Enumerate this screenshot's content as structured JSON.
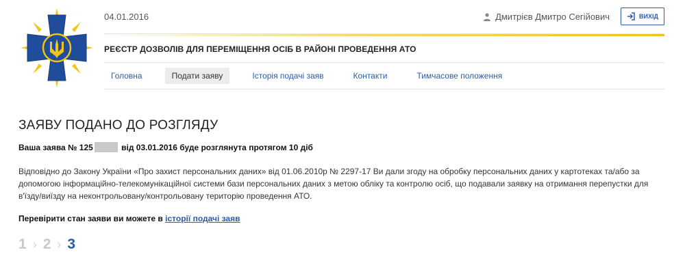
{
  "header": {
    "date": "04.01.2016",
    "user_name": "Дмитрієв Дмитро Сегійович",
    "logout_label": "ВИХІД",
    "site_title": "РЕЄСТР ДОЗВОЛІВ ДЛЯ ПЕРЕМІЩЕННЯ ОСІБ В РАЙОНІ ПРОВЕДЕННЯ АТО"
  },
  "nav": {
    "items": [
      {
        "label": "Головна"
      },
      {
        "label": "Подати заяву",
        "active": true
      },
      {
        "label": "Історія подачі заяв"
      },
      {
        "label": "Контакти"
      },
      {
        "label": "Тимчасове положення"
      }
    ]
  },
  "main": {
    "title": "ЗАЯВУ ПОДАНО ДО РОЗГЛЯДУ",
    "application_prefix": "Ваша заява № 125",
    "application_suffix": "від 03.01.2016 буде розглянута протягом 10 діб",
    "consent_text": "Відповідно до Закону України «Про захист персональних даних» від 01.06.2010р № 2297-17 Ви дали згоду на обробку персональних даних у картотеках та/або за допомогою інформаційно-телекомунікаційної системи бази персональних даних з метою обліку та контролю осіб, що подавали заявку на отримання перепустки для в'їзду/виїзду на неконтрольовану/контрольовану територію проведення АТО.",
    "check_status_prefix": "Перевірити стан заяви ви можете в",
    "check_status_link": "історії подачі заяв"
  },
  "steps": {
    "items": [
      "1",
      "2",
      "3"
    ],
    "current": 3
  },
  "colors": {
    "accent": "#2a5ca8",
    "emblem_blue": "#1f4d9b",
    "emblem_gold": "#f0c419",
    "stripe_yellow": "#f0c419"
  }
}
